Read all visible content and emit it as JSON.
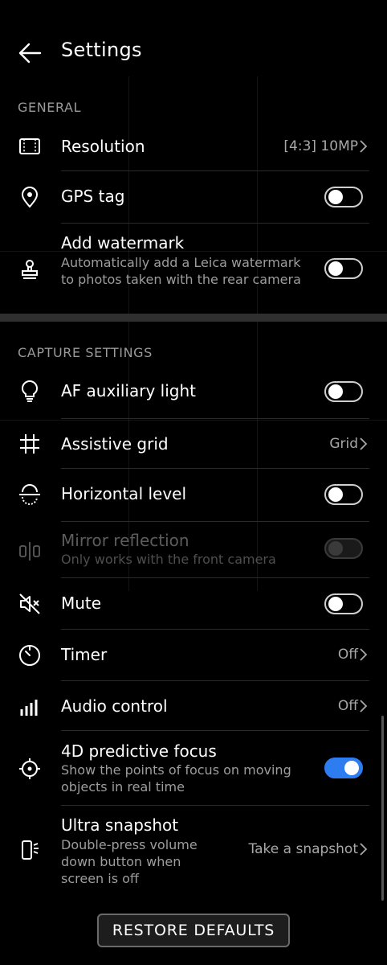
{
  "header": {
    "title": "Settings"
  },
  "general": {
    "heading": "GENERAL",
    "resolution": {
      "label": "Resolution",
      "value": "[4:3]  10MP"
    },
    "gps": {
      "label": "GPS tag",
      "on": false
    },
    "watermark": {
      "label": "Add watermark",
      "sub": "Automatically add a Leica watermark to photos taken with the rear camera",
      "on": false
    }
  },
  "capture": {
    "heading": "CAPTURE SETTINGS",
    "af_light": {
      "label": "AF auxiliary light",
      "on": false
    },
    "grid": {
      "label": "Assistive grid",
      "value": "Grid"
    },
    "level": {
      "label": "Horizontal level",
      "on": false
    },
    "mirror": {
      "label": "Mirror reflection",
      "sub": "Only works with the front camera",
      "on": false,
      "enabled": false
    },
    "mute": {
      "label": "Mute",
      "on": false
    },
    "timer": {
      "label": "Timer",
      "value": "Off"
    },
    "audio": {
      "label": "Audio control",
      "value": "Off"
    },
    "focus": {
      "label": "4D predictive focus",
      "sub": "Show the points of focus on moving objects in real time",
      "on": true
    },
    "snapshot": {
      "label": "Ultra snapshot",
      "sub": "Double-press volume down button when screen is off",
      "value": "Take a snapshot"
    }
  },
  "footer": {
    "restore_label": "RESTORE DEFAULTS"
  },
  "colors": {
    "accent": "#2d7cf0",
    "background": "#000000",
    "muted_text": "#9d9d9d"
  }
}
